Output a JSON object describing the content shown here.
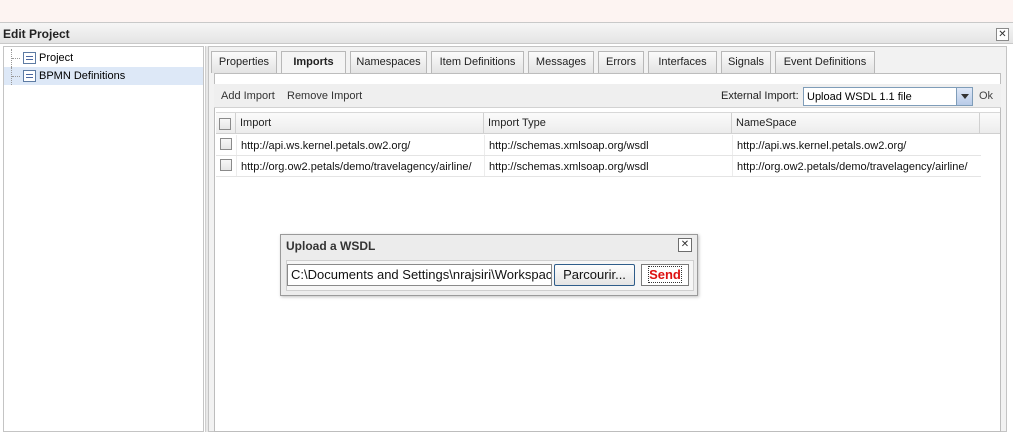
{
  "window": {
    "title": "Edit Project"
  },
  "tree": {
    "items": [
      "Project",
      "BPMN Definitions"
    ]
  },
  "tabs": [
    "Properties",
    "Imports",
    "Namespaces",
    "Item Definitions",
    "Messages",
    "Errors",
    "Interfaces",
    "Signals",
    "Event Definitions"
  ],
  "active_tab": "Imports",
  "toolbar": {
    "add_label": "Add Import",
    "remove_label": "Remove Import",
    "external_label": "External Import:",
    "select_value": "Upload WSDL 1.1 file",
    "ok_label": "Ok"
  },
  "grid": {
    "headers": [
      "Import",
      "Import Type",
      "NameSpace"
    ],
    "rows": [
      [
        "http://api.ws.kernel.petals.ow2.org/",
        "http://schemas.xmlsoap.org/wsdl",
        "http://api.ws.kernel.petals.ow2.org/"
      ],
      [
        "http://org.ow2.petals/demo/travelagency/airline/",
        "http://schemas.xmlsoap.org/wsdl",
        "http://org.ow2.petals/demo/travelagency/airline/"
      ]
    ]
  },
  "dialog": {
    "title": "Upload a WSDL",
    "file_value": "C:\\Documents and Settings\\nrajsiri\\Workspace",
    "browse_label": "Parcourir...",
    "send_label": "Send"
  }
}
